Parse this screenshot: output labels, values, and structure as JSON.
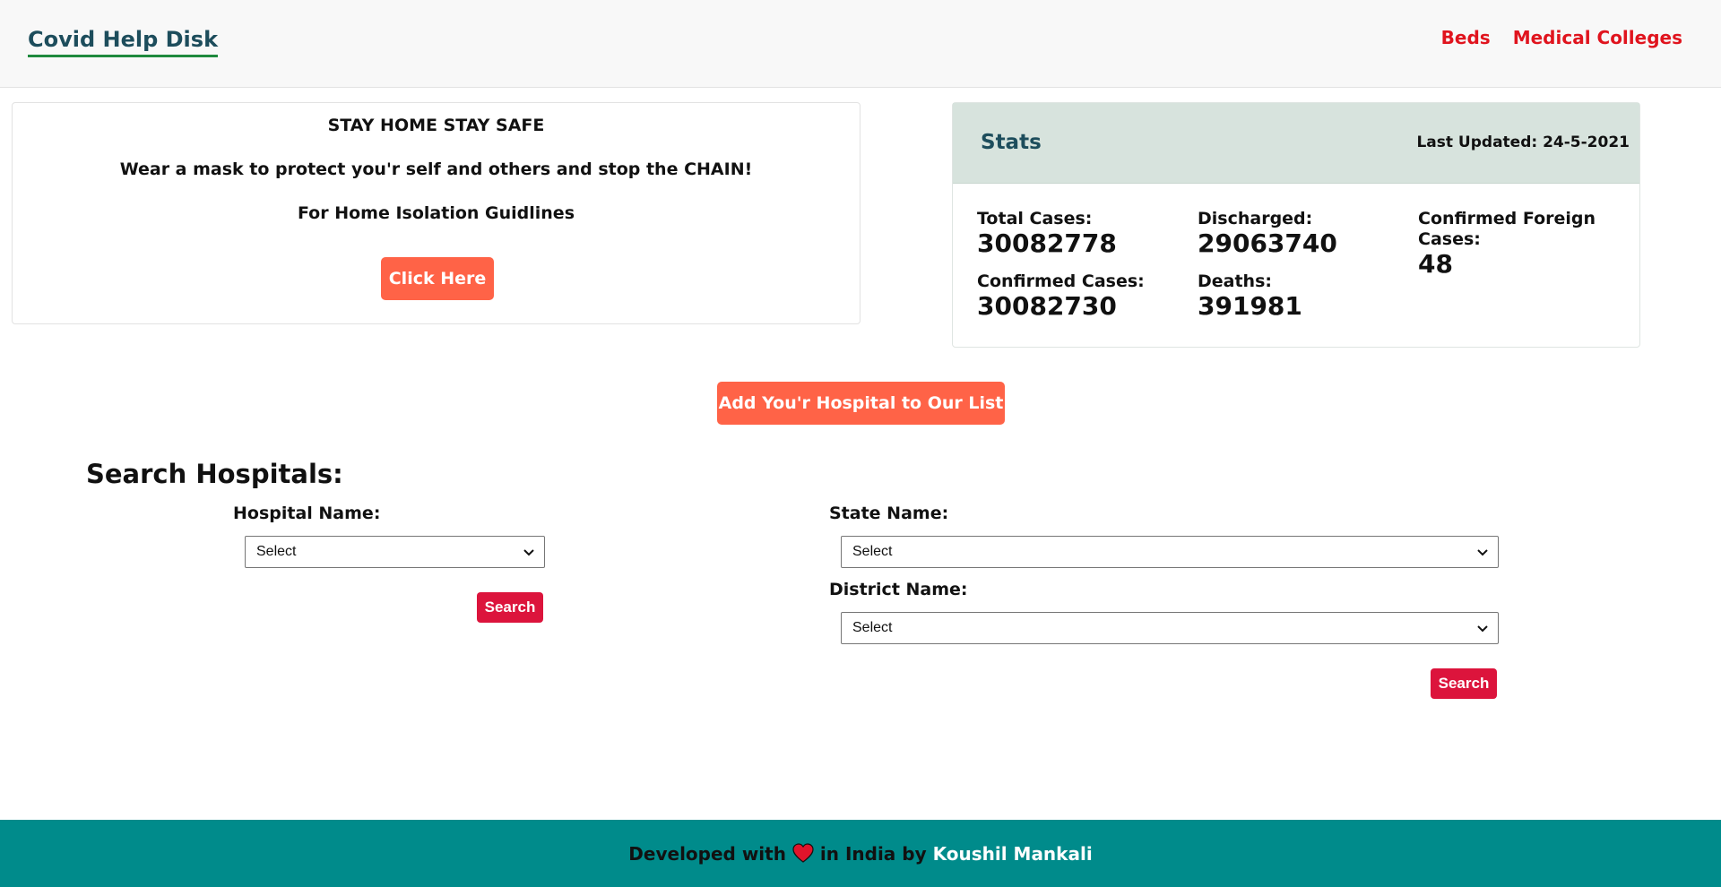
{
  "header": {
    "brand": "Covid Help Disk",
    "nav": [
      "Beds",
      "Medical Colleges"
    ]
  },
  "info": {
    "line1": "STAY HOME STAY SAFE",
    "line2": "Wear a mask to protect you'r self and others and stop the CHAIN!",
    "line3": "For Home Isolation Guidlines",
    "button": "Click Here"
  },
  "stats": {
    "title": "Stats",
    "last_updated": "Last Updated: 24-5-2021",
    "items": [
      {
        "label": "Total Cases:",
        "value": "30082778"
      },
      {
        "label": "Discharged:",
        "value": "29063740"
      },
      {
        "label": "Confirmed Foreign Cases:",
        "value": "48"
      },
      {
        "label": "Confirmed Cases:",
        "value": "30082730"
      },
      {
        "label": "Deaths:",
        "value": "391981"
      }
    ]
  },
  "add_hospital_button": "Add You'r Hospital to Our List",
  "search": {
    "title": "Search Hospitals:",
    "hospital_label": "Hospital Name:",
    "hospital_value": "Select",
    "state_label": "State Name:",
    "state_value": "Select",
    "district_label": "District Name:",
    "district_value": "Select",
    "button": "Search"
  },
  "footer": {
    "prefix": "Developed with",
    "middle": "in India by",
    "author": "Koushil Mankali"
  },
  "colors": {
    "accent_orange": "#ff6347",
    "search_red": "#dc143c",
    "footer_teal": "#008b8b",
    "nav_red": "#e0141e"
  }
}
